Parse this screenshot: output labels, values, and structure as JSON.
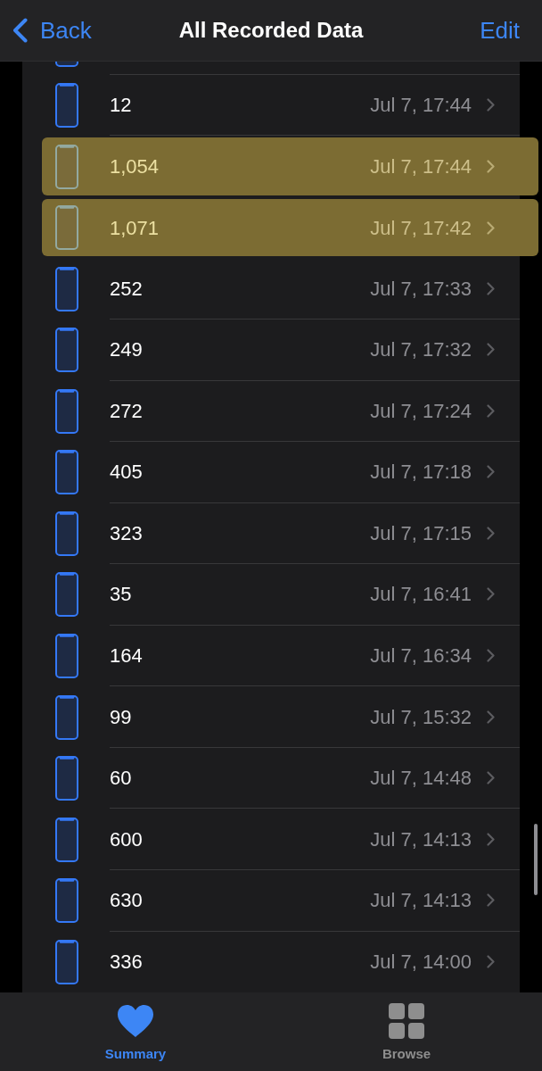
{
  "nav_bar": {
    "back": "Back",
    "title": "All Recorded Data",
    "action": "Edit"
  },
  "records": [
    {
      "value": "12",
      "date": "Jul 7, 17:44",
      "highlighted": false
    },
    {
      "value": "1,054",
      "date": "Jul 7, 17:44",
      "highlighted": true
    },
    {
      "value": "1,071",
      "date": "Jul 7, 17:42",
      "highlighted": true
    },
    {
      "value": "252",
      "date": "Jul 7, 17:33",
      "highlighted": false
    },
    {
      "value": "249",
      "date": "Jul 7, 17:32",
      "highlighted": false
    },
    {
      "value": "272",
      "date": "Jul 7, 17:24",
      "highlighted": false
    },
    {
      "value": "405",
      "date": "Jul 7, 17:18",
      "highlighted": false
    },
    {
      "value": "323",
      "date": "Jul 7, 17:15",
      "highlighted": false
    },
    {
      "value": "35",
      "date": "Jul 7, 16:41",
      "highlighted": false
    },
    {
      "value": "164",
      "date": "Jul 7, 16:34",
      "highlighted": false
    },
    {
      "value": "99",
      "date": "Jul 7, 15:32",
      "highlighted": false
    },
    {
      "value": "60",
      "date": "Jul 7, 14:48",
      "highlighted": false
    },
    {
      "value": "600",
      "date": "Jul 7, 14:13",
      "highlighted": false
    },
    {
      "value": "630",
      "date": "Jul 7, 14:13",
      "highlighted": false
    },
    {
      "value": "336",
      "date": "Jul 7, 14:00",
      "highlighted": false
    }
  ],
  "tab_bar": [
    {
      "label": "Summary",
      "kind": "heart",
      "selected": true
    },
    {
      "label": "Browse",
      "kind": "grid",
      "selected": false
    }
  ]
}
